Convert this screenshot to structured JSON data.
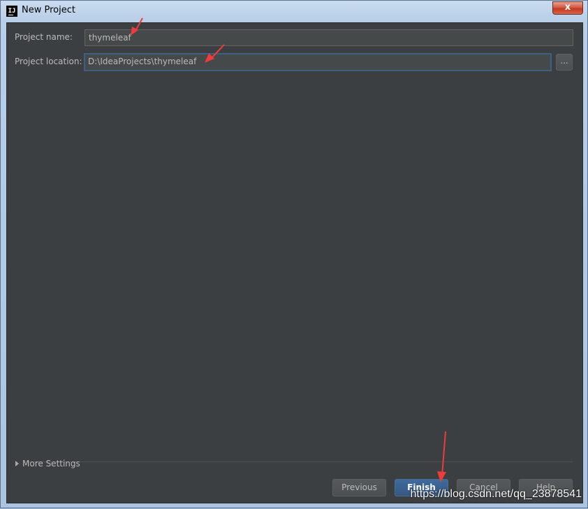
{
  "window": {
    "title": "New Project",
    "close_label": "x"
  },
  "form": {
    "name_label": "Project name:",
    "name_value": "thymeleaf",
    "location_label": "Project location:",
    "location_value": "D:\\IdeaProjects\\thymeleaf",
    "browse_label": "..."
  },
  "more_settings": {
    "label": "More Settings"
  },
  "buttons": {
    "previous": "Previous",
    "finish": "Finish",
    "cancel": "Cancel",
    "help": "Help"
  },
  "annotations": {
    "arrow_color": "#ee3b3b"
  },
  "watermark": {
    "text": "https://blog.csdn.net/qq_23878541"
  },
  "theme": {
    "dialog_bg": "#3c3f41",
    "field_bg": "#45494a",
    "focus_border": "#3d6185",
    "text": "#bbbbbb",
    "primary_button": "#365880"
  }
}
